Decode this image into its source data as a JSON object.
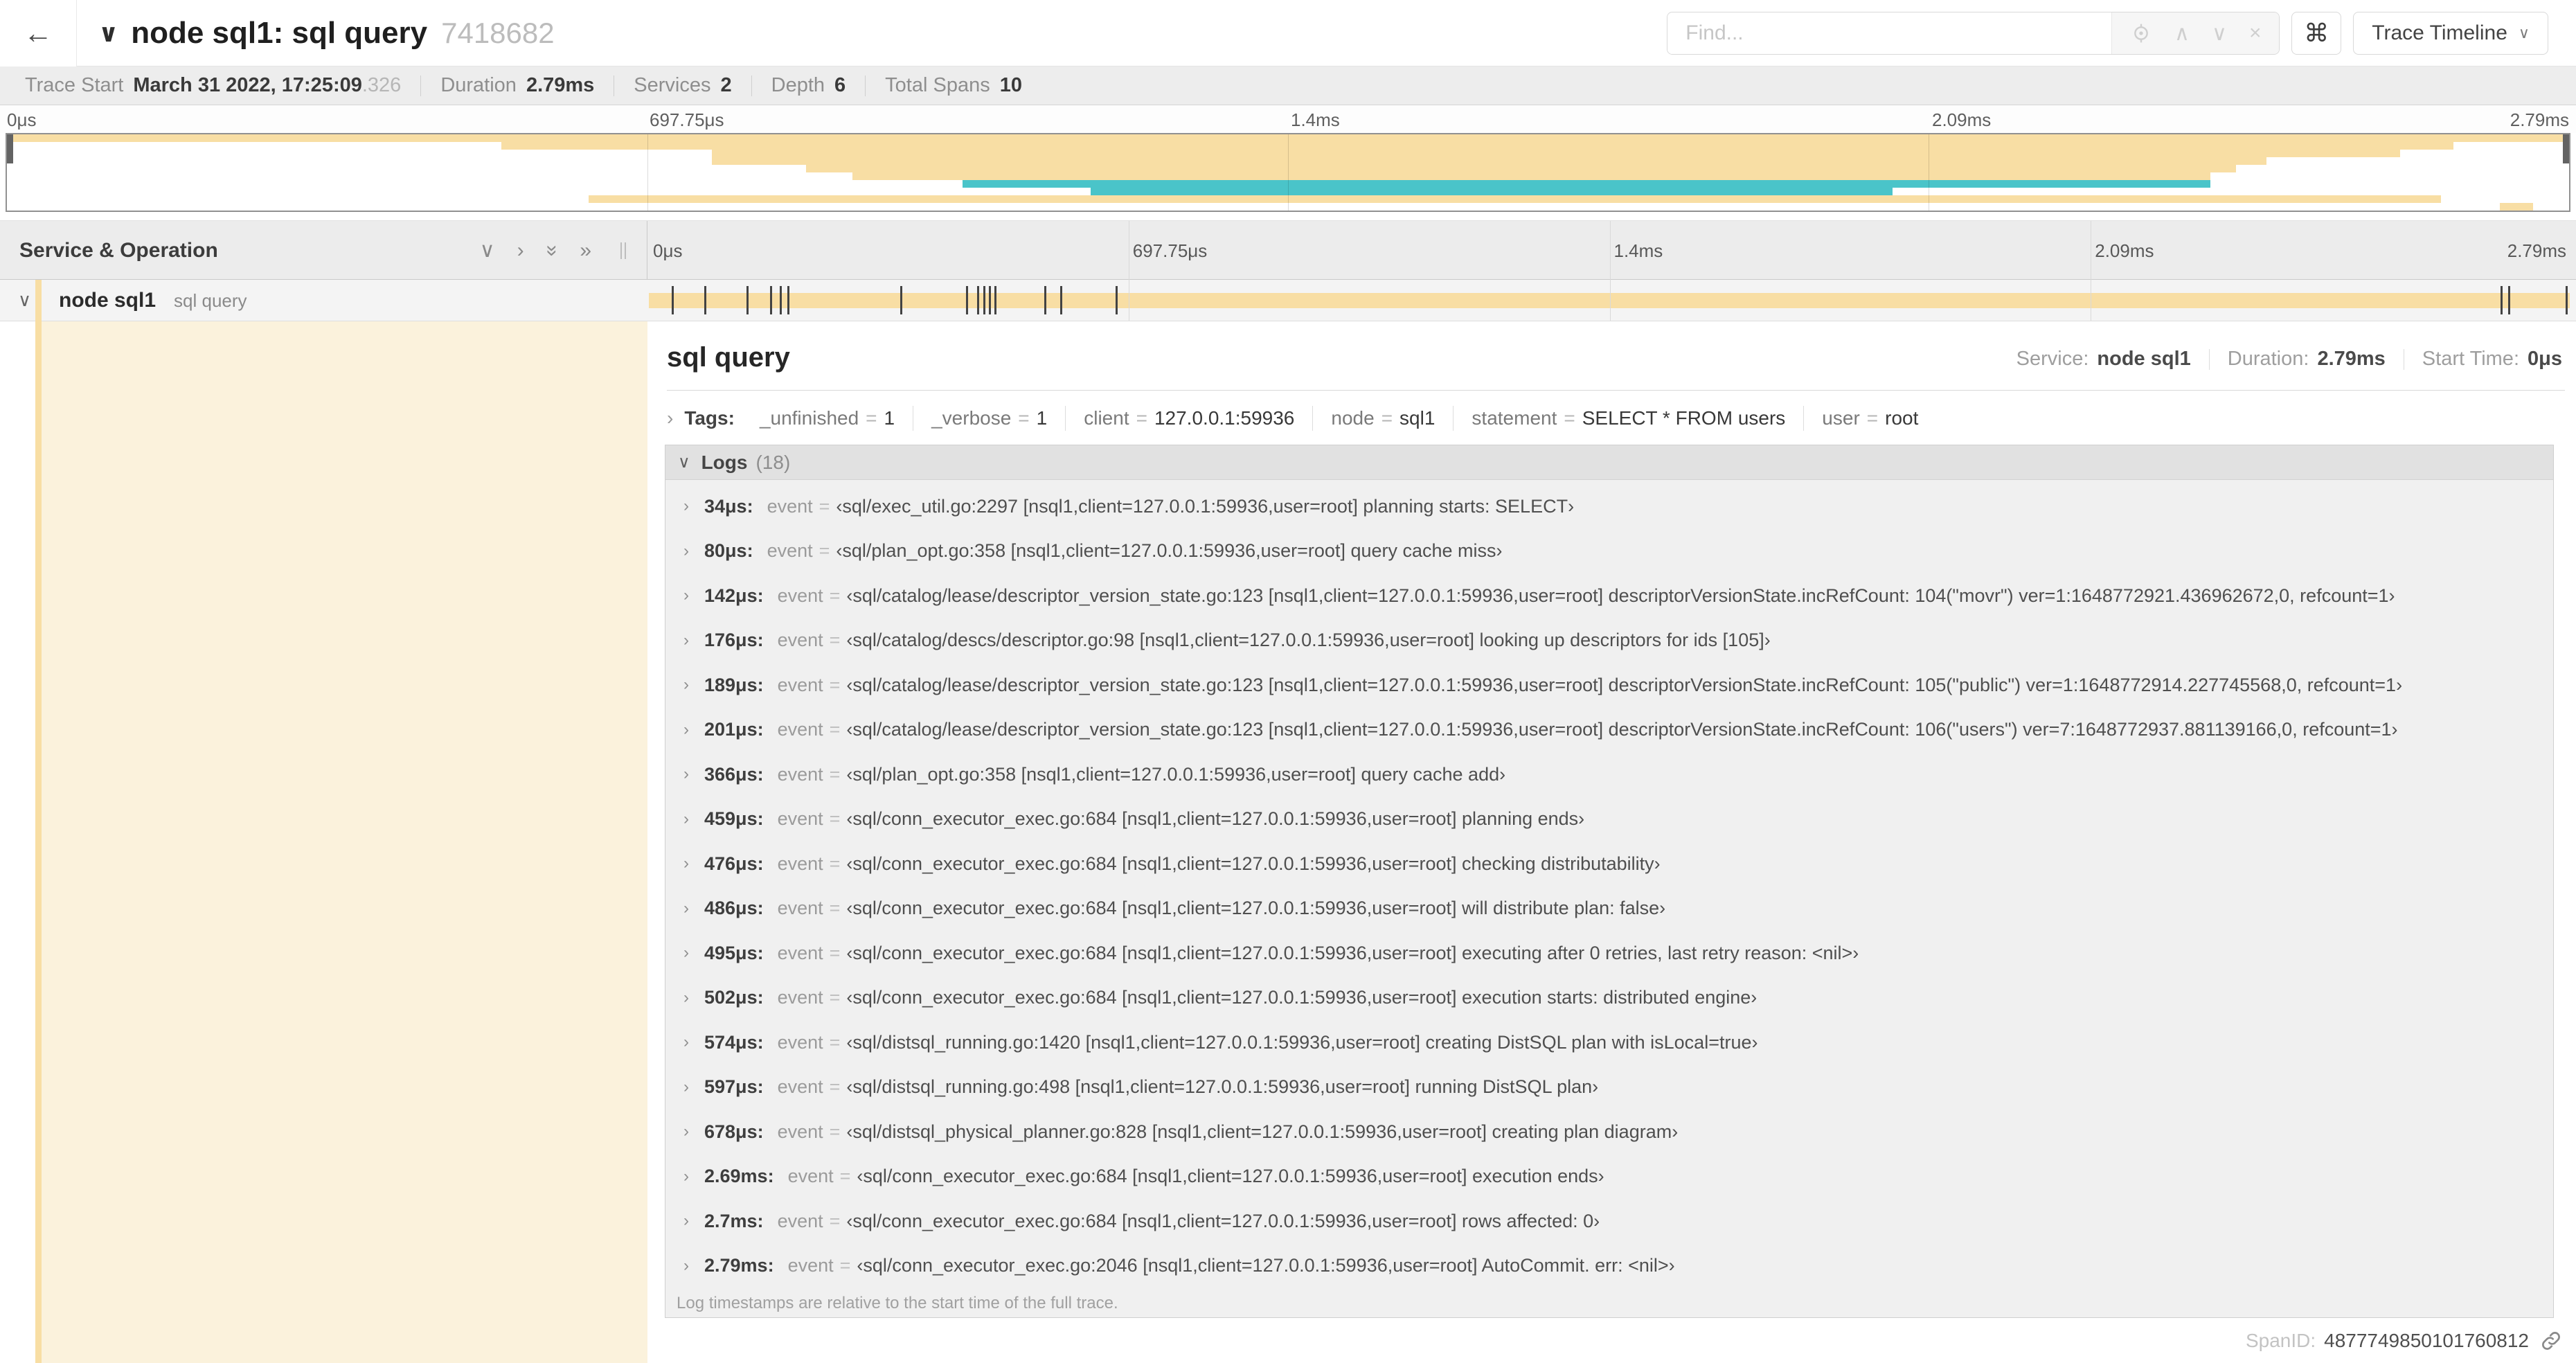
{
  "colors": {
    "tan": "#F8DEA4",
    "teal": "#4AC4C9",
    "cream": "#FBF2DC"
  },
  "glyphs": {
    "back": "←",
    "chevron_down": "∨",
    "chevron_right": "›",
    "double_chevron": "»",
    "up": "∧",
    "down": "∨",
    "close": "×",
    "command": "⌘",
    "eq": "="
  },
  "header": {
    "title": "node sql1: sql query",
    "trace_id": "7418682",
    "find_placeholder": "Find...",
    "view_selector": "Trace Timeline"
  },
  "summary": {
    "items": [
      {
        "label": "Trace Start",
        "value": "March 31 2022, 17:25:09",
        "suffix": ".326"
      },
      {
        "label": "Duration",
        "value": "2.79ms",
        "suffix": ""
      },
      {
        "label": "Services",
        "value": "2",
        "suffix": ""
      },
      {
        "label": "Depth",
        "value": "6",
        "suffix": ""
      },
      {
        "label": "Total Spans",
        "value": "10",
        "suffix": ""
      }
    ]
  },
  "timebar": {
    "ticks": [
      "0μs",
      "697.75μs",
      "1.4ms",
      "2.09ms",
      "2.79ms"
    ]
  },
  "minimap": {
    "spans": [
      {
        "s": 0,
        "e": 100,
        "c": "tan"
      },
      {
        "s": 19.3,
        "e": 95.5,
        "c": "tan"
      },
      {
        "s": 27.5,
        "e": 93.4,
        "c": "tan"
      },
      {
        "s": 27.5,
        "e": 88.2,
        "c": "tan"
      },
      {
        "s": 31.2,
        "e": 87.0,
        "c": "tan"
      },
      {
        "s": 33.0,
        "e": 86.0,
        "c": "tan"
      },
      {
        "s": 37.3,
        "e": 86.0,
        "c": "teal"
      },
      {
        "s": 42.3,
        "e": 73.6,
        "c": "teal"
      },
      {
        "s": 22.7,
        "e": 95.0,
        "c": "tan"
      },
      {
        "s": 97.3,
        "e": 98.6,
        "c": "tan"
      }
    ]
  },
  "timeline": {
    "header": "Service & Operation",
    "row": {
      "service": "node sql1",
      "operation": "sql query"
    },
    "log_marks": [
      1.2,
      2.9,
      5.1,
      6.3,
      6.8,
      7.2,
      13.1,
      16.5,
      17.1,
      17.4,
      17.7,
      18.0,
      20.6,
      21.4,
      24.3,
      96.4,
      96.8,
      99.8
    ]
  },
  "detail": {
    "title": "sql query",
    "service_label": "Service:",
    "service": "node sql1",
    "duration_label": "Duration:",
    "duration": "2.79ms",
    "start_label": "Start Time:",
    "start": "0μs",
    "tags_label": "Tags:",
    "tags": [
      {
        "key": "_unfinished",
        "value": "1"
      },
      {
        "key": "_verbose",
        "value": "1"
      },
      {
        "key": "client",
        "value": "127.0.0.1:59936"
      },
      {
        "key": "node",
        "value": "sql1"
      },
      {
        "key": "statement",
        "value": "SELECT * FROM users"
      },
      {
        "key": "user",
        "value": "root"
      }
    ],
    "logs": {
      "label": "Logs",
      "count": "(18)",
      "field_key": "event",
      "entries": [
        {
          "t": "34μs:",
          "v": "‹sql/exec_util.go:2297 [nsql1,client=127.0.0.1:59936,user=root] planning starts: SELECT›"
        },
        {
          "t": "80μs:",
          "v": "‹sql/plan_opt.go:358 [nsql1,client=127.0.0.1:59936,user=root] query cache miss›"
        },
        {
          "t": "142μs:",
          "v": "‹sql/catalog/lease/descriptor_version_state.go:123 [nsql1,client=127.0.0.1:59936,user=root] descriptorVersionState.incRefCount: 104(\"movr\") ver=1:1648772921.436962672,0, refcount=1›"
        },
        {
          "t": "176μs:",
          "v": "‹sql/catalog/descs/descriptor.go:98 [nsql1,client=127.0.0.1:59936,user=root] looking up descriptors for ids [105]›"
        },
        {
          "t": "189μs:",
          "v": "‹sql/catalog/lease/descriptor_version_state.go:123 [nsql1,client=127.0.0.1:59936,user=root] descriptorVersionState.incRefCount: 105(\"public\") ver=1:1648772914.227745568,0, refcount=1›"
        },
        {
          "t": "201μs:",
          "v": "‹sql/catalog/lease/descriptor_version_state.go:123 [nsql1,client=127.0.0.1:59936,user=root] descriptorVersionState.incRefCount: 106(\"users\") ver=7:1648772937.881139166,0, refcount=1›"
        },
        {
          "t": "366μs:",
          "v": "‹sql/plan_opt.go:358 [nsql1,client=127.0.0.1:59936,user=root] query cache add›"
        },
        {
          "t": "459μs:",
          "v": "‹sql/conn_executor_exec.go:684 [nsql1,client=127.0.0.1:59936,user=root] planning ends›"
        },
        {
          "t": "476μs:",
          "v": "‹sql/conn_executor_exec.go:684 [nsql1,client=127.0.0.1:59936,user=root] checking distributability›"
        },
        {
          "t": "486μs:",
          "v": "‹sql/conn_executor_exec.go:684 [nsql1,client=127.0.0.1:59936,user=root] will distribute plan: false›"
        },
        {
          "t": "495μs:",
          "v": "‹sql/conn_executor_exec.go:684 [nsql1,client=127.0.0.1:59936,user=root] executing after 0 retries, last retry reason: <nil>›"
        },
        {
          "t": "502μs:",
          "v": "‹sql/conn_executor_exec.go:684 [nsql1,client=127.0.0.1:59936,user=root] execution starts: distributed engine›"
        },
        {
          "t": "574μs:",
          "v": "‹sql/distsql_running.go:1420 [nsql1,client=127.0.0.1:59936,user=root] creating DistSQL plan with isLocal=true›"
        },
        {
          "t": "597μs:",
          "v": "‹sql/distsql_running.go:498 [nsql1,client=127.0.0.1:59936,user=root] running DistSQL plan›"
        },
        {
          "t": "678μs:",
          "v": "‹sql/distsql_physical_planner.go:828 [nsql1,client=127.0.0.1:59936,user=root] creating plan diagram›"
        },
        {
          "t": "2.69ms:",
          "v": "‹sql/conn_executor_exec.go:684 [nsql1,client=127.0.0.1:59936,user=root] execution ends›"
        },
        {
          "t": "2.7ms:",
          "v": "‹sql/conn_executor_exec.go:684 [nsql1,client=127.0.0.1:59936,user=root] rows affected: 0›"
        },
        {
          "t": "2.79ms:",
          "v": "‹sql/conn_executor_exec.go:2046 [nsql1,client=127.0.0.1:59936,user=root] AutoCommit. err: <nil>›"
        }
      ],
      "footnote": "Log timestamps are relative to the start time of the full trace."
    },
    "span_id_label": "SpanID:",
    "span_id": "4877749850101760812"
  }
}
